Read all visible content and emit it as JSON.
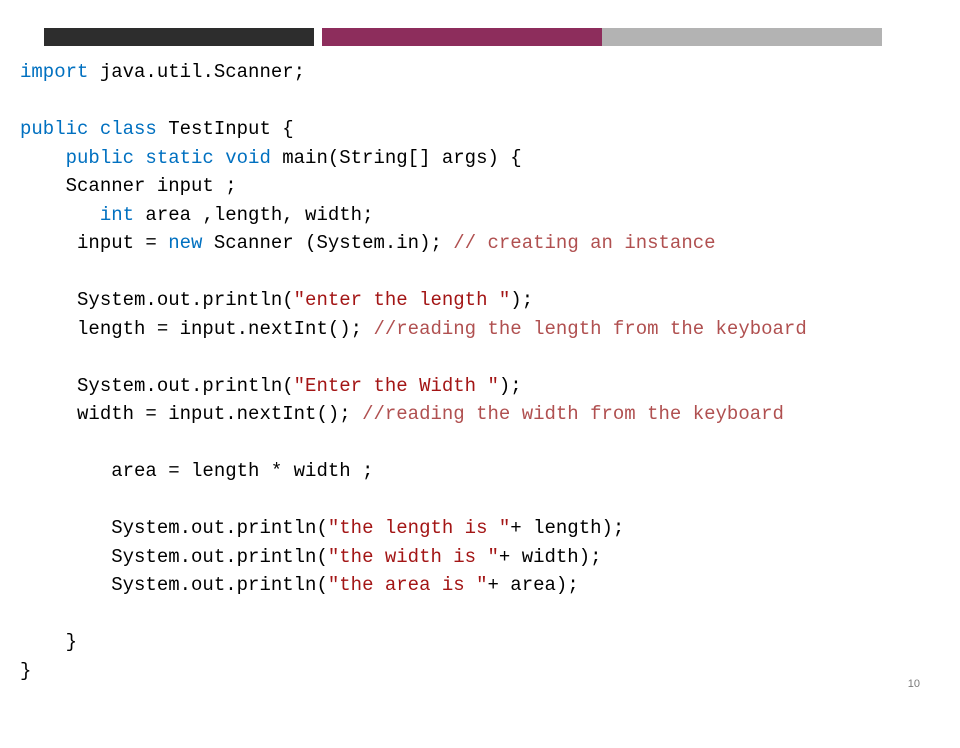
{
  "code": {
    "l1": {
      "import": "import",
      "pkg": " java.util.Scanner;"
    },
    "l2_public": "public",
    "l2_class": " class",
    "l2_name": " TestInput {",
    "l3_mods": "    public static void",
    "l3_rest": " main(String[] args) {",
    "l4": "    Scanner input ;",
    "l5_int": "       int",
    "l5_rest": " area ,length, width;",
    "l6_a": "     input = ",
    "l6_new": "new",
    "l6_b": " Scanner (System.in); ",
    "l6_c": "// creating an instance",
    "l7_a": "     System.out.println(",
    "l7_s": "\"enter the length \"",
    "l7_b": ");",
    "l8_a": "     length = input.nextInt(); ",
    "l8_c": "//reading the length from the keyboard",
    "l9_a": "     System.out.println(",
    "l9_s": "\"Enter the Width \"",
    "l9_b": ");",
    "l10_a": "     width = input.nextInt(); ",
    "l10_c": "//reading the width from the keyboard",
    "l11": "        area = length * width ;",
    "l12_a": "        System.out.println(",
    "l12_s": "\"the length is \"",
    "l12_b": "+ length);",
    "l13_a": "        System.out.println(",
    "l13_s": "\"the width is \"",
    "l13_b": "+ width);",
    "l14_a": "        System.out.println(",
    "l14_s": "\"the area is \"",
    "l14_b": "+ area);",
    "l15": "    }",
    "l16": "}"
  },
  "page_num": "10"
}
